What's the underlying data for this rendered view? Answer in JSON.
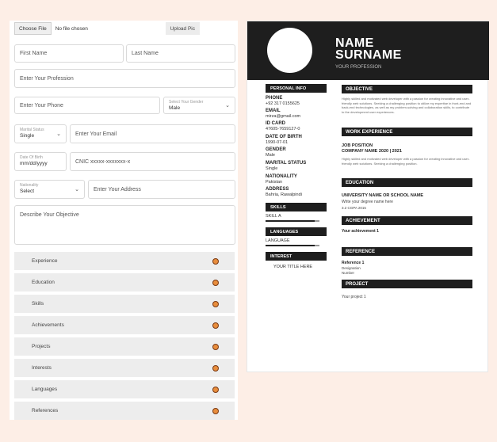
{
  "form": {
    "choose_file": "Choose File",
    "no_file": "No file chosen",
    "upload_pic": "Upload Pic",
    "first_name": "First Name",
    "last_name": "Last Name",
    "profession": "Enter Your Profession",
    "phone": "Enter Your Phone",
    "gender_caption": "Select Your Gender",
    "gender_value": "Male",
    "marital_caption": "Marital Status",
    "marital_value": "Single",
    "email": "Enter Your Email",
    "dob_caption": "Date Of Birth",
    "dob_value": "mm/dd/yyyy",
    "cnic": "CNIC xxxxx-xxxxxxx-x",
    "nationality_caption": "Nationality",
    "nationality_value": "Select",
    "address": "Enter Your Address",
    "objective": "Describe Your Objective"
  },
  "accordion": [
    "Experience",
    "Education",
    "Skills",
    "Achievements",
    "Projects",
    "Interests",
    "Languages",
    "References"
  ],
  "resume": {
    "name_line1": "NAME",
    "name_line2": "SURNAME",
    "profession": "YOUR PROFESSION",
    "personal_info": "PERSONAL INFO",
    "phone_label": "PHONE",
    "phone_value": "+92 317 0155625",
    "email_label": "EMAIL",
    "email_value": "mirza@gmail.com",
    "id_label": "ID CARD",
    "id_value": "47605-7659127-0",
    "dob_label": "DATE OF BIRTH",
    "dob_value": "1990-07-01",
    "gender_label": "GENDER",
    "gender_value": "Male",
    "marital_label": "MARITAL STATUS",
    "marital_value": "Single",
    "nationality_label": "NATIONALITY",
    "nationality_value": "Pakistan",
    "address_label": "ADDRESS",
    "address_value": "Bahria, Rawalpindi",
    "skills_title": "SKILLS",
    "skill_item": "SKILL A",
    "languages_title": "LANGUAGES",
    "language_item": "LANGUAGE",
    "interest_title": "INTEREST",
    "interest_item": "YOUR TITLE HERE",
    "objective_title": "OBJECTIVE",
    "objective_text": "Highly skilled and motivated web developer with a passion for creating innovative and user-friendly web solutions. Seeking a challenging position to utilize my expertise in front-end and back-end technologies, as well as my problem-solving and collaboration skills, to contribute to the development user experiences.",
    "work_title": "WORK EXPERIENCE",
    "job_position": "JOB POSITION",
    "company": "COMPANY NAME 2020 | 2021",
    "work_text": "Highly skilled and motivated web developer with a passion for creating innovative and user-friendly web solutions. Seeking a challenging position.",
    "education_title": "EDUCATION",
    "university": "UNIVERSITY NAME OR SCHOOL NAME",
    "degree": "Write your degree name here",
    "cgpa": "3.2 CGPA 2015",
    "achievement_title": "ACHIEVEMENT",
    "achievement_item": "Your achievement 1",
    "reference_title": "REFERENCE",
    "reference_name": "Reference 1",
    "reference_designation": "Designation",
    "reference_number": "Number",
    "project_title": "PROJECT",
    "project_item": "Your project 1"
  },
  "colors": {
    "accent_dot": "#e88d3c",
    "resume_dark": "#1e1e1e",
    "page_bg": "#fdeee6"
  }
}
